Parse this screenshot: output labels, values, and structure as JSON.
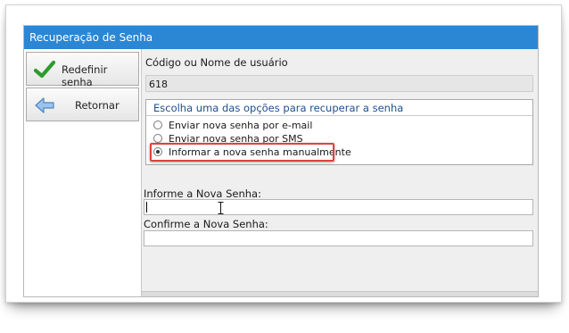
{
  "window": {
    "title": "Recuperação de Senha"
  },
  "left_buttons": {
    "reset_label": "Redefinir senha",
    "reset_icon": "checkmark-icon",
    "back_label": "Retornar",
    "back_icon": "arrow-left-icon"
  },
  "user": {
    "label": "Código ou Nome de usuário",
    "value": "618"
  },
  "options": {
    "title": "Escolha uma das opções para recuperar a senha",
    "items": [
      {
        "label": "Enviar nova senha por e-mail",
        "selected": false
      },
      {
        "label": "Enviar nova senha por SMS",
        "selected": false
      },
      {
        "label": "Informar a nova senha manualmente",
        "selected": true
      }
    ]
  },
  "new_password": {
    "label": "Informe a Nova Senha:",
    "value": ""
  },
  "confirm_password": {
    "label": "Confirme a Nova Senha:",
    "value": ""
  },
  "colors": {
    "titlebar": "#2b86d3",
    "highlight": "#e0413a",
    "check": "#2e9b2e",
    "arrow": "#5b9bd5"
  }
}
